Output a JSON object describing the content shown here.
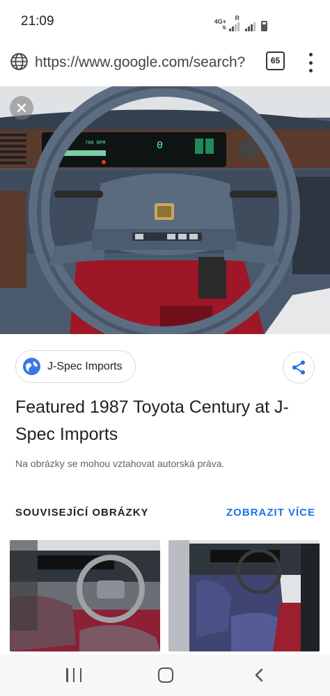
{
  "status_bar": {
    "time": "21:09",
    "network_label": "4G+",
    "roaming_label": "R",
    "icons": [
      "signal-icon",
      "signal-icon",
      "battery-icon"
    ]
  },
  "browser": {
    "url": "https://www.google.com/search?",
    "tab_count": "65",
    "icons": [
      "globe-icon",
      "tabs-icon",
      "more-vert-icon"
    ]
  },
  "preview": {
    "image_icon": "close-icon",
    "source": {
      "name": "J-Spec Imports",
      "logo_icon": "globe-favicon-icon"
    },
    "share_icon": "share-icon",
    "title": "Featured 1987 Toyota Century at J-Spec Imports",
    "copyright_note": "Na obrázky se mohou vztahovat autorská práva."
  },
  "related": {
    "heading": "SOUVISEJÍCÍ OBRÁZKY",
    "show_more": "ZOBRAZIT VÍCE",
    "thumbnails": [
      "car-interior-image",
      "car-interior-image"
    ]
  },
  "nav_bar": {
    "icons": [
      "recent-apps-icon",
      "home-icon",
      "back-icon"
    ]
  },
  "colors": {
    "accent": "#1a73e8",
    "text_primary": "#202124",
    "text_secondary": "#5f6368",
    "divider": "#dadce0"
  }
}
